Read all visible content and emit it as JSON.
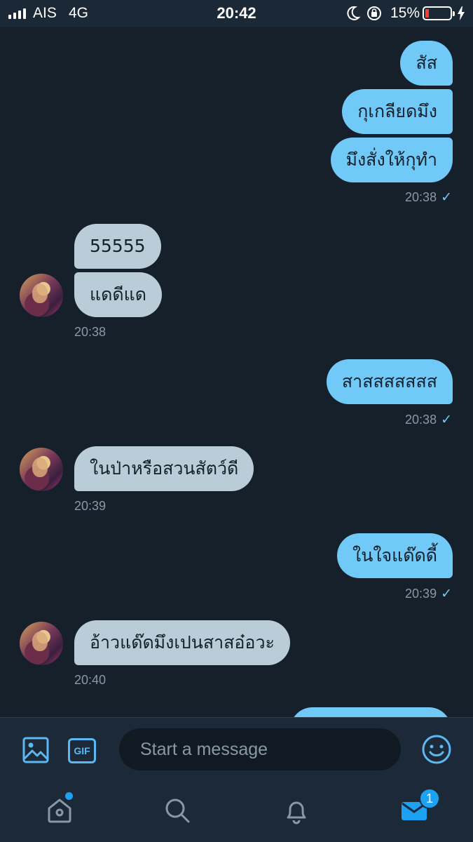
{
  "status_bar": {
    "carrier": "AIS",
    "network": "4G",
    "time": "20:42",
    "battery_percent": "15%",
    "icons": [
      "signal-icon",
      "moon-icon",
      "rotation-lock-icon",
      "battery-icon",
      "charging-icon"
    ]
  },
  "messages": [
    {
      "direction": "out",
      "text": "สัส"
    },
    {
      "direction": "out",
      "text": "กุเกลียดมึง"
    },
    {
      "direction": "out",
      "text": "มึงสั่งให้กุทำ"
    },
    {
      "direction": "out-time",
      "time": "20:38",
      "status": "✓"
    },
    {
      "direction": "in",
      "text": "55555"
    },
    {
      "direction": "in",
      "text": "แดดีแด"
    },
    {
      "direction": "in-time",
      "time": "20:38"
    },
    {
      "direction": "out",
      "text": "สาสสสสสสส"
    },
    {
      "direction": "out-time",
      "time": "20:38",
      "status": "✓"
    },
    {
      "direction": "in",
      "text": "ในป่าหรือสวนสัตว์ดี"
    },
    {
      "direction": "in-time",
      "time": "20:39"
    },
    {
      "direction": "out",
      "text": "ในใจแด๊ดดี้"
    },
    {
      "direction": "out-time",
      "time": "20:39",
      "status": "✓"
    },
    {
      "direction": "in",
      "text": "อ้าวแด๊ดมึงเปนสาสอ๋อวะ"
    },
    {
      "direction": "in-time",
      "time": "20:40"
    }
  ],
  "composer": {
    "placeholder": "Start a message",
    "gif_label": "GIF"
  },
  "tab_bar": {
    "tabs": [
      "home",
      "search",
      "notifications",
      "messages"
    ],
    "messages_badge": "1"
  },
  "colors": {
    "background": "#15202b",
    "outgoing_bubble": "#71c9f8",
    "incoming_bubble": "#b9ccd8",
    "accent": "#1da1f2",
    "timestamp": "#8899a6"
  }
}
